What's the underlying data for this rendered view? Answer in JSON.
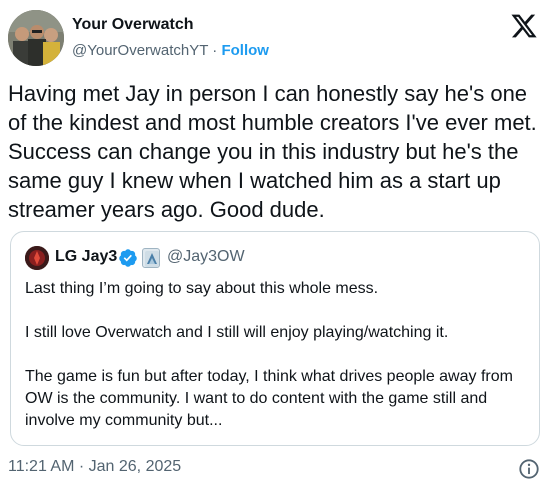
{
  "author": {
    "name": "Your Overwatch",
    "handle": "@YourOverwatchYT",
    "separator": " · ",
    "follow_label": "Follow"
  },
  "tweet": {
    "text": "Having met Jay in person I can honestly say he's one of the kindest and most humble creators I've ever met. Success can change you in this industry but he's the same guy I knew when I watched him as a start up streamer years ago. Good dude."
  },
  "quote": {
    "name": "LG Jay3",
    "handle": "@Jay3OW",
    "paragraphs": [
      "Last thing I’m going to say about this whole mess.",
      "I still love Overwatch and I still will enjoy playing/watching it.",
      "The game is fun but after today, I think what drives people away from OW is the community. I want to do content with the game still and involve my community but..."
    ]
  },
  "meta": {
    "timestamp": "11:21 AM · Jan 26, 2025"
  },
  "icons": {
    "x_logo": "x-logo-icon",
    "verified": "verified-badge-icon",
    "affiliate": "affiliate-badge-icon",
    "info": "info-icon"
  },
  "colors": {
    "text": "#0f1419",
    "secondary": "#536471",
    "accent": "#1d9bf0",
    "border": "#cfd9de"
  }
}
